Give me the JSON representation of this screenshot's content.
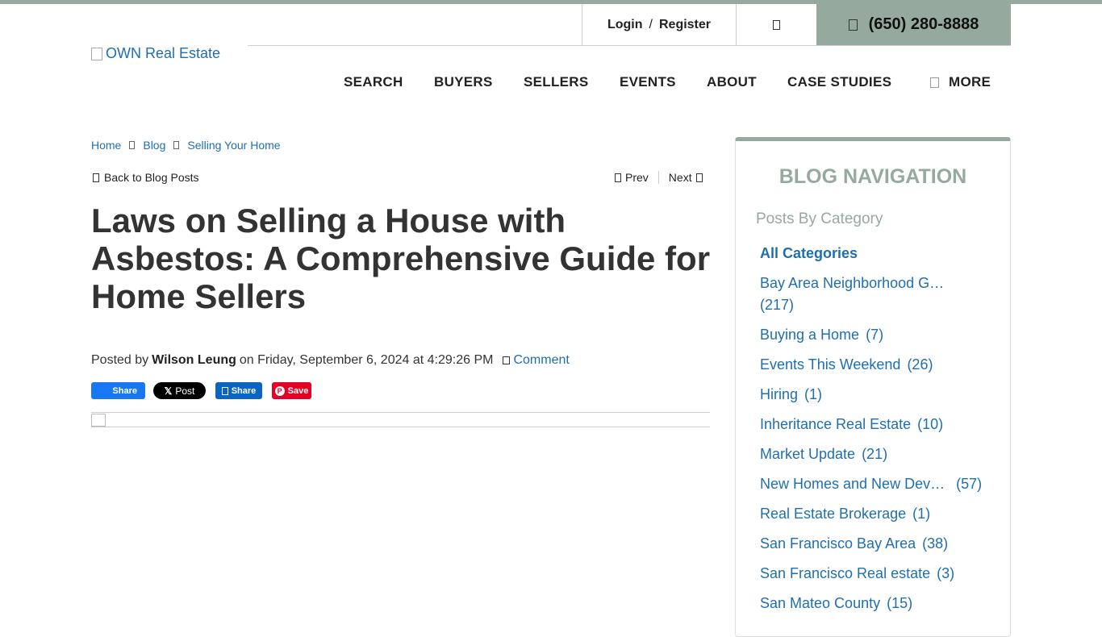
{
  "header": {
    "logo_alt": "OWN Real Estate",
    "login": "Login",
    "separator": "/",
    "register": "Register",
    "phone": "(650) 280-8888"
  },
  "nav": {
    "search": "SEARCH",
    "buyers": "BUYERS",
    "sellers": "SELLERS",
    "events": "EVENTS",
    "about": "ABOUT",
    "case_studies": "CASE STUDIES",
    "more": "MORE"
  },
  "breadcrumb": [
    "Home",
    "Blog",
    "Selling Your Home"
  ],
  "post_nav": {
    "back": "Back to Blog Posts",
    "prev": "Prev",
    "next": "Next"
  },
  "post": {
    "title": "Laws on Selling a House with Asbestos: A Comprehensive Guide for Home Sellers",
    "posted_by": "Posted by",
    "author": "Wilson Leung",
    "date": "on Friday, September 6, 2024 at 4:29:26 PM",
    "comment": "Comment"
  },
  "share": {
    "facebook": "Share",
    "x": "Post",
    "linkedin": "Share",
    "pinterest": "Save"
  },
  "sidebar": {
    "title": "BLOG NAVIGATION",
    "subtitle": "Posts By Category",
    "all": "All Categories",
    "categories": [
      {
        "name": "Bay Area Neighborhood G…",
        "count": "(217)"
      },
      {
        "name": "Buying a Home",
        "count": "(7)"
      },
      {
        "name": "Events This Weekend",
        "count": "(26)"
      },
      {
        "name": "Hiring",
        "count": "(1)"
      },
      {
        "name": "Inheritance Real Estate",
        "count": "(10)"
      },
      {
        "name": "Market Update",
        "count": "(21)"
      },
      {
        "name": "New Homes and New Dev…",
        "count": "(57)"
      },
      {
        "name": "Real Estate Brokerage",
        "count": "(1)"
      },
      {
        "name": "San Francisco Bay Area",
        "count": "(38)"
      },
      {
        "name": "San Francisco Real estate",
        "count": "(3)"
      },
      {
        "name": "San Mateo County",
        "count": "(15)"
      }
    ]
  },
  "colors": {
    "accent": "#95a99f",
    "link": "#1f6fae",
    "facebook": "#1877f2",
    "linkedin": "#0a66c2",
    "pinterest": "#e60023"
  }
}
